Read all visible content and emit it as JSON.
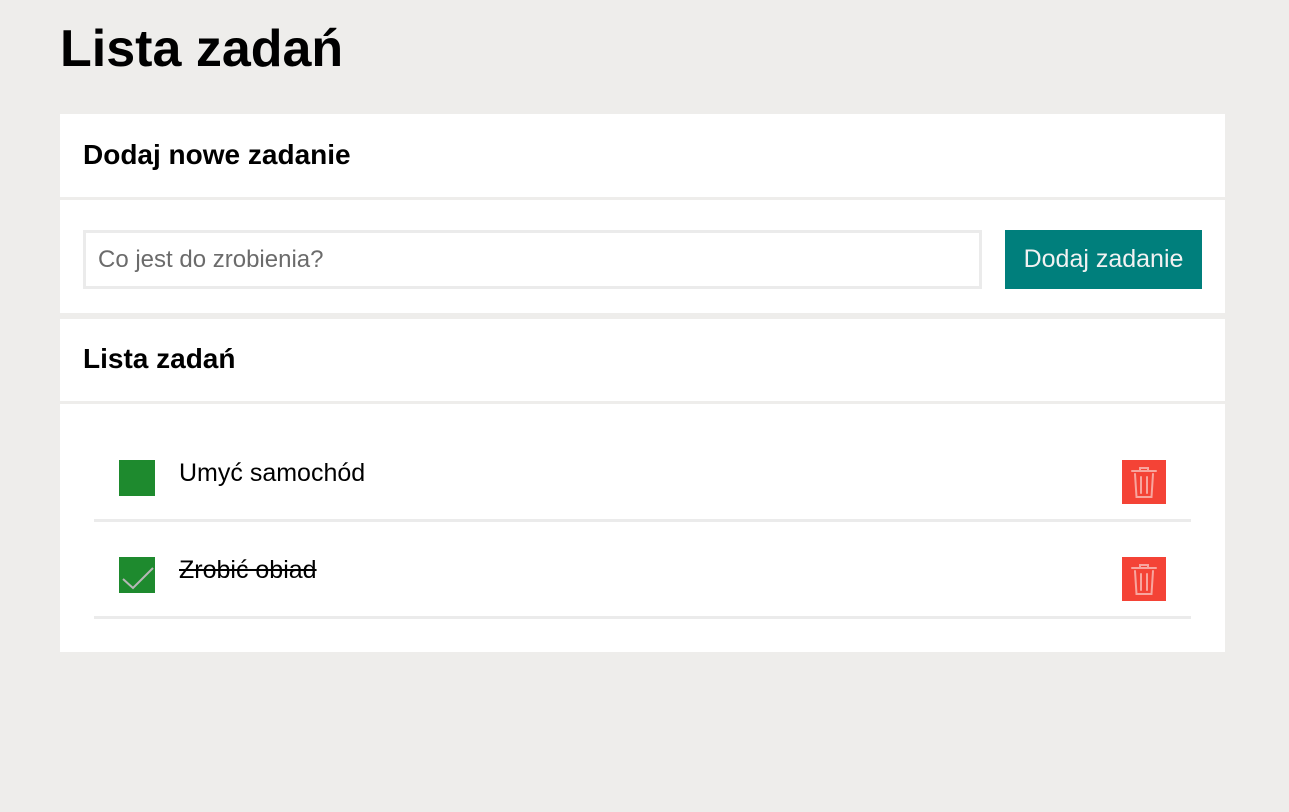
{
  "page": {
    "title": "Lista zadań"
  },
  "add_panel": {
    "heading": "Dodaj nowe zadanie",
    "input_value": "",
    "input_placeholder": "Co jest do zrobienia?",
    "button_label": "Dodaj zadanie"
  },
  "list_panel": {
    "heading": "Lista zadań",
    "tasks": [
      {
        "text": "Umyć samochód",
        "completed": false
      },
      {
        "text": "Zrobić obiad",
        "completed": true
      }
    ]
  },
  "colors": {
    "background": "#eeedeb",
    "panel": "#ffffff",
    "accent": "#007f7c",
    "checkbox": "#1e8a2e",
    "delete": "#f44336",
    "divider": "#ebebeb"
  },
  "icons": {
    "checkbox_checked": "check-icon",
    "delete": "trash-icon"
  }
}
